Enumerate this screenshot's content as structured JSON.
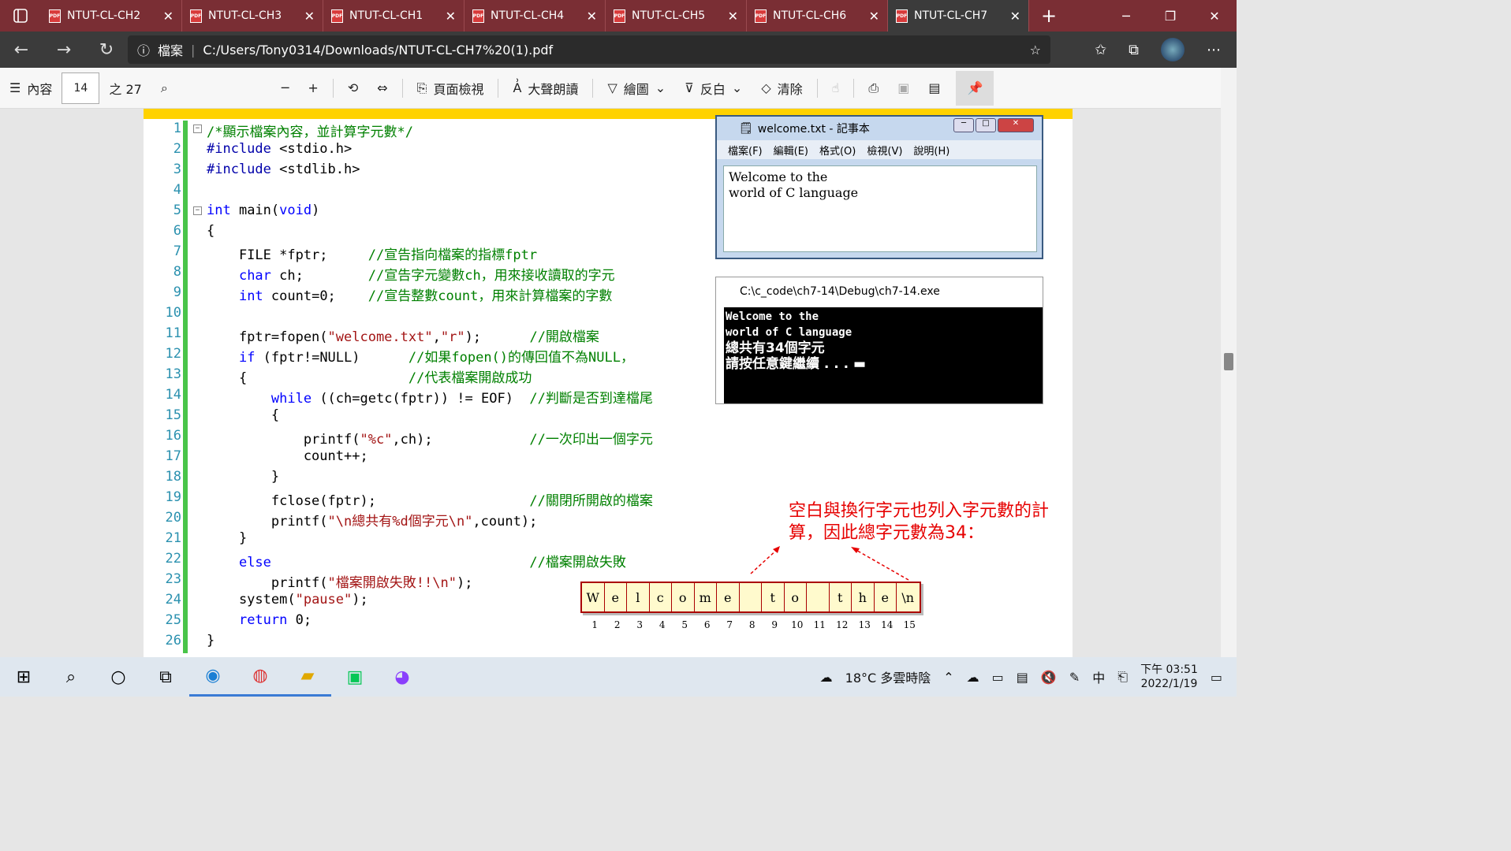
{
  "tabs": [
    {
      "label": "NTUT-CL-CH2"
    },
    {
      "label": "NTUT-CL-CH3"
    },
    {
      "label": "NTUT-CL-CH1"
    },
    {
      "label": "NTUT-CL-CH4"
    },
    {
      "label": "NTUT-CL-CH5"
    },
    {
      "label": "NTUT-CL-CH6"
    },
    {
      "label": "NTUT-CL-CH7"
    }
  ],
  "address": {
    "scheme": "檔案",
    "url": "C:/Users/Tony0314/Downloads/NTUT-CL-CH7%20(1).pdf"
  },
  "pdf_toolbar": {
    "contents": "內容",
    "page": "14",
    "of": "之 27",
    "page_view": "頁面檢視",
    "read_aloud": "大聲朗讀",
    "draw": "繪圖",
    "highlight": "反白",
    "erase": "清除"
  },
  "code": [
    {
      "n": "1",
      "t": "/*顯示檔案內容，並計算字元數*/"
    },
    {
      "n": "2",
      "t": "#include <stdio.h>"
    },
    {
      "n": "3",
      "t": "#include <stdlib.h>"
    },
    {
      "n": "4",
      "t": ""
    },
    {
      "n": "5",
      "t": "int main(void)"
    },
    {
      "n": "6",
      "t": "{"
    },
    {
      "n": "7",
      "t": "    FILE *fptr;     //宣告指向檔案的指標fptr"
    },
    {
      "n": "8",
      "t": "    char ch;        //宣告字元變數ch，用來接收讀取的字元"
    },
    {
      "n": "9",
      "t": "    int count=0;    //宣告整數count，用來計算檔案的字數"
    },
    {
      "n": "10",
      "t": ""
    },
    {
      "n": "11",
      "t": "    fptr=fopen(\"welcome.txt\",\"r\");      //開啟檔案"
    },
    {
      "n": "12",
      "t": "    if (fptr!=NULL)      //如果fopen()的傳回值不為NULL，"
    },
    {
      "n": "13",
      "t": "    {                    //代表檔案開啟成功"
    },
    {
      "n": "14",
      "t": "        while ((ch=getc(fptr)) != EOF)  //判斷是否到達檔尾"
    },
    {
      "n": "15",
      "t": "        {"
    },
    {
      "n": "16",
      "t": "            printf(\"%c\",ch);            //一次印出一個字元"
    },
    {
      "n": "17",
      "t": "            count++;"
    },
    {
      "n": "18",
      "t": "        }"
    },
    {
      "n": "19",
      "t": "        fclose(fptr);                   //關閉所開啟的檔案"
    },
    {
      "n": "20",
      "t": "        printf(\"\\n總共有%d個字元\\n\",count);"
    },
    {
      "n": "21",
      "t": "    }"
    },
    {
      "n": "22",
      "t": "    else                                //檔案開啟失敗"
    },
    {
      "n": "23",
      "t": "        printf(\"檔案開啟失敗!!\\n\");"
    },
    {
      "n": "24",
      "t": "    system(\"pause\");"
    },
    {
      "n": "25",
      "t": "    return 0;"
    },
    {
      "n": "26",
      "t": "}"
    }
  ],
  "notepad": {
    "title": "welcome.txt - 記事本",
    "menu": [
      "檔案(F)",
      "編輯(E)",
      "格式(O)",
      "檢視(V)",
      "說明(H)"
    ],
    "line1": "Welcome to the",
    "line2": "world of C language"
  },
  "console": {
    "title": "C:\\c_code\\ch7-14\\Debug\\ch7-14.exe",
    "line1": "Welcome to the",
    "line2": "world of C language",
    "line3": "總共有34個字元",
    "line4": "請按任意鍵繼續 . . . ▬"
  },
  "note": "空白與換行字元也列入字元數的計算，因此總字元數為34：",
  "cells": [
    "W",
    "e",
    "l",
    "c",
    "o",
    "m",
    "e",
    "",
    "t",
    "o",
    "",
    "t",
    "h",
    "e",
    "\\n"
  ],
  "cell_numbers": [
    "1",
    "2",
    "3",
    "4",
    "5",
    "6",
    "7",
    "8",
    "9",
    "10",
    "11",
    "12",
    "13",
    "14",
    "15"
  ],
  "taskbar": {
    "weather": "18°C 多雲時陰",
    "ime": "中",
    "time": "下午 03:51",
    "date": "2022/1/19"
  }
}
